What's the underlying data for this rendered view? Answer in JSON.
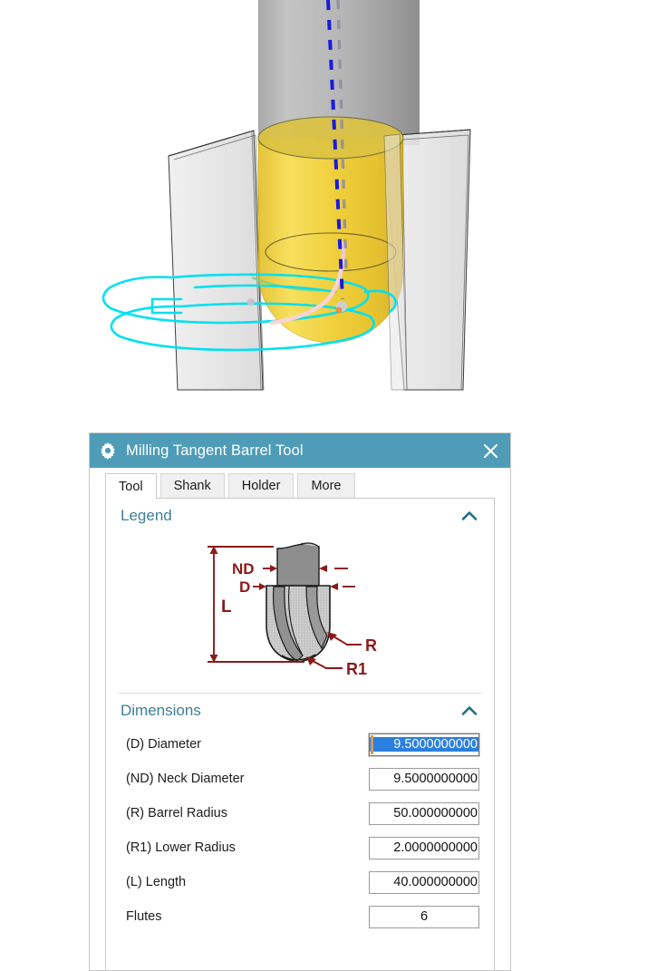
{
  "viewport": {
    "name": "3d-tool-simulation-view",
    "description": "CAM simulation of a tangent barrel milling tool cutting a workpiece",
    "colors": {
      "background": "#ffffff",
      "shank_gray_light": "#b9b9b9",
      "shank_gray_dark": "#969696",
      "barrel_yellow_light": "#f3d63c",
      "barrel_yellow_mid": "#e8c31c",
      "barrel_yellow_dark": "#cfae18",
      "barrel_top_face": "#d9c24a",
      "workpiece_fill": "#e9e9e9",
      "workpiece_edge": "#3a3a3a",
      "toolpath_cyan": "#00e0f0",
      "axis_blue": "#1a1ae0",
      "axis_gray": "#8a8a9a",
      "lead_pink": "#f6cfd0",
      "contact_point_orange": "#f0903a",
      "contact_point_gray": "#c9c9c9",
      "tangent_green": "#7fd98a"
    }
  },
  "dialog": {
    "title": "Milling Tangent Barrel Tool",
    "gear_icon": "gear-icon",
    "close_icon": "close-icon",
    "accent_color": "#4e9cb8",
    "tabs": [
      {
        "label": "Tool",
        "active": true
      },
      {
        "label": "Shank",
        "active": false
      },
      {
        "label": "Holder",
        "active": false
      },
      {
        "label": "More",
        "active": false
      }
    ],
    "sections": {
      "legend": {
        "title": "Legend",
        "collapse_icon": "chevron-up-icon",
        "expanded": true,
        "diagram": {
          "name": "barrel-tool-legend-diagram",
          "annotation_color": "#8b1a1a",
          "labels": [
            "ND",
            "D",
            "L",
            "R",
            "R1"
          ]
        }
      },
      "dimensions": {
        "title": "Dimensions",
        "collapse_icon": "chevron-up-icon",
        "expanded": true,
        "fields": [
          {
            "label": "(D) Diameter",
            "value": "9.5000000000",
            "focused": true,
            "selected": true,
            "align": "right"
          },
          {
            "label": "(ND) Neck Diameter",
            "value": "9.5000000000",
            "focused": false,
            "selected": false,
            "align": "right"
          },
          {
            "label": "(R) Barrel Radius",
            "value": "50.000000000",
            "focused": false,
            "selected": false,
            "align": "right"
          },
          {
            "label": "(R1) Lower Radius",
            "value": "2.0000000000",
            "focused": false,
            "selected": false,
            "align": "right"
          },
          {
            "label": "(L) Length",
            "value": "40.000000000",
            "focused": false,
            "selected": false,
            "align": "right"
          },
          {
            "label": "Flutes",
            "value": "6",
            "focused": false,
            "selected": false,
            "align": "center"
          }
        ]
      }
    }
  }
}
